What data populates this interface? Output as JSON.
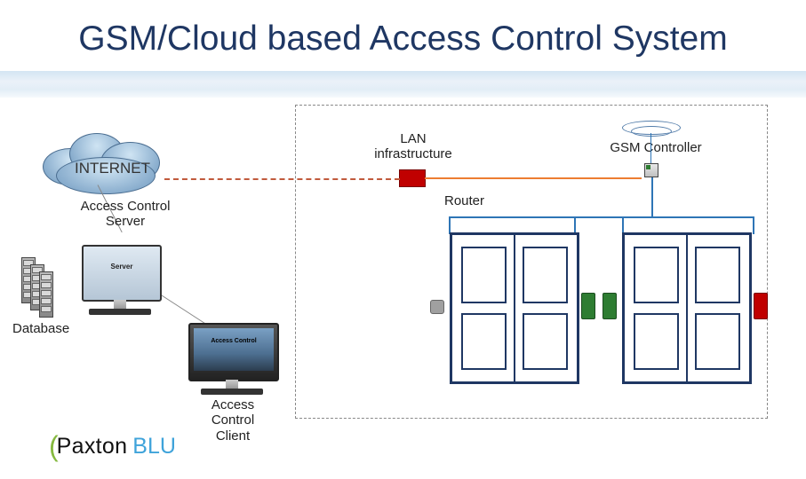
{
  "title": "GSM/Cloud based Access Control System",
  "cloud_label": "INTERNET",
  "server_label": "Access Control\nServer",
  "server_inner": "Server",
  "database_label": "Database",
  "client_label": "Access Control\nClient",
  "client_inner": "Access Control",
  "lan_label": "LAN\ninfrastructure",
  "router_label": "Router",
  "controller_label": "GSM Controller",
  "logo": {
    "brace": "(",
    "brand": "Paxton",
    "sub": "BLU"
  },
  "colors": {
    "title": "#1f3763",
    "orange": "#ed7d31",
    "navy": "#2e75b6",
    "red": "#c00000",
    "green": "#2e7d32"
  }
}
